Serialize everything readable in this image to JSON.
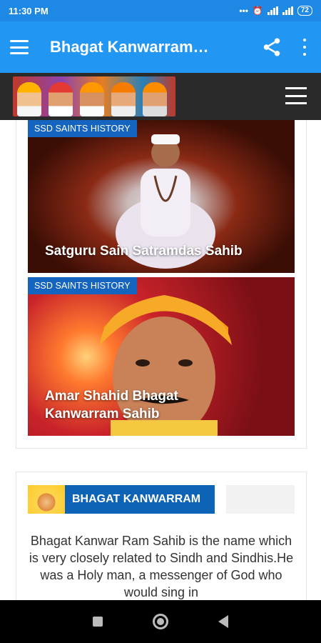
{
  "status": {
    "time": "11:30 PM",
    "battery": "72",
    "icons": [
      "dots-icon",
      "alarm-icon",
      "signal-icon",
      "signal-icon",
      "battery-icon"
    ]
  },
  "app_bar": {
    "title": "Bhagat Kanwarram…",
    "icons": [
      "menu-icon",
      "share-icon",
      "more-vert-icon"
    ]
  },
  "posts": [
    {
      "category": "SSD SAINTS HISTORY",
      "title_lines": [
        "Satguru Sain Satramdas Sahib"
      ]
    },
    {
      "category": "SSD SAINTS HISTORY",
      "title_lines": [
        "Amar Shahid Bhagat",
        "Kanwarram Sahib"
      ]
    }
  ],
  "widget": {
    "title": "BHAGAT KANWARRAM",
    "text": "Bhagat Kanwar Ram Sahib is the name which is very closely related to Sindh and Sindhis.He was a Holy man, a messenger of God who would sing in"
  },
  "colors": {
    "status_bar": "#1e88e5",
    "app_bar": "#2196f3",
    "tag": "#1565c0",
    "widget_header": "#0d63b5"
  }
}
